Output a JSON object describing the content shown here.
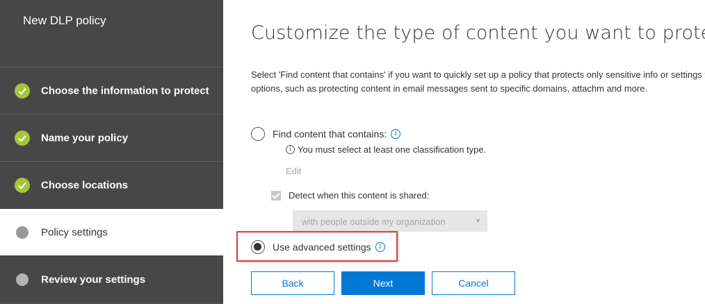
{
  "wizard": {
    "title": "New DLP policy",
    "steps": [
      {
        "label": "Choose the information to protect",
        "status": "complete"
      },
      {
        "label": "Name your policy",
        "status": "complete"
      },
      {
        "label": "Choose locations",
        "status": "complete"
      },
      {
        "label": "Policy settings",
        "status": "current"
      },
      {
        "label": "Review your settings",
        "status": "pending"
      }
    ]
  },
  "main": {
    "title": "Customize the type of content you want to protect",
    "description": "Select 'Find content that contains' if you want to quickly set up a policy that protects only sensitive info or settings for more options, such as protecting content in email messages sent to specific domains, attachm and more.",
    "option_find": {
      "label": "Find content that contains:",
      "selected": false,
      "hint": "You must select at least one classification type.",
      "edit_label": "Edit",
      "detect_shared": {
        "label": "Detect when this content is shared:",
        "checked": true,
        "dropdown_value": "with people outside my organization"
      }
    },
    "option_advanced": {
      "label": "Use advanced settings",
      "selected": true
    }
  },
  "buttons": {
    "back": "Back",
    "next": "Next",
    "cancel": "Cancel"
  },
  "colors": {
    "sidebar_bg": "#474747",
    "step_complete": "#a4c639",
    "accent": "#0078d4",
    "highlight": "#e03c3c"
  }
}
